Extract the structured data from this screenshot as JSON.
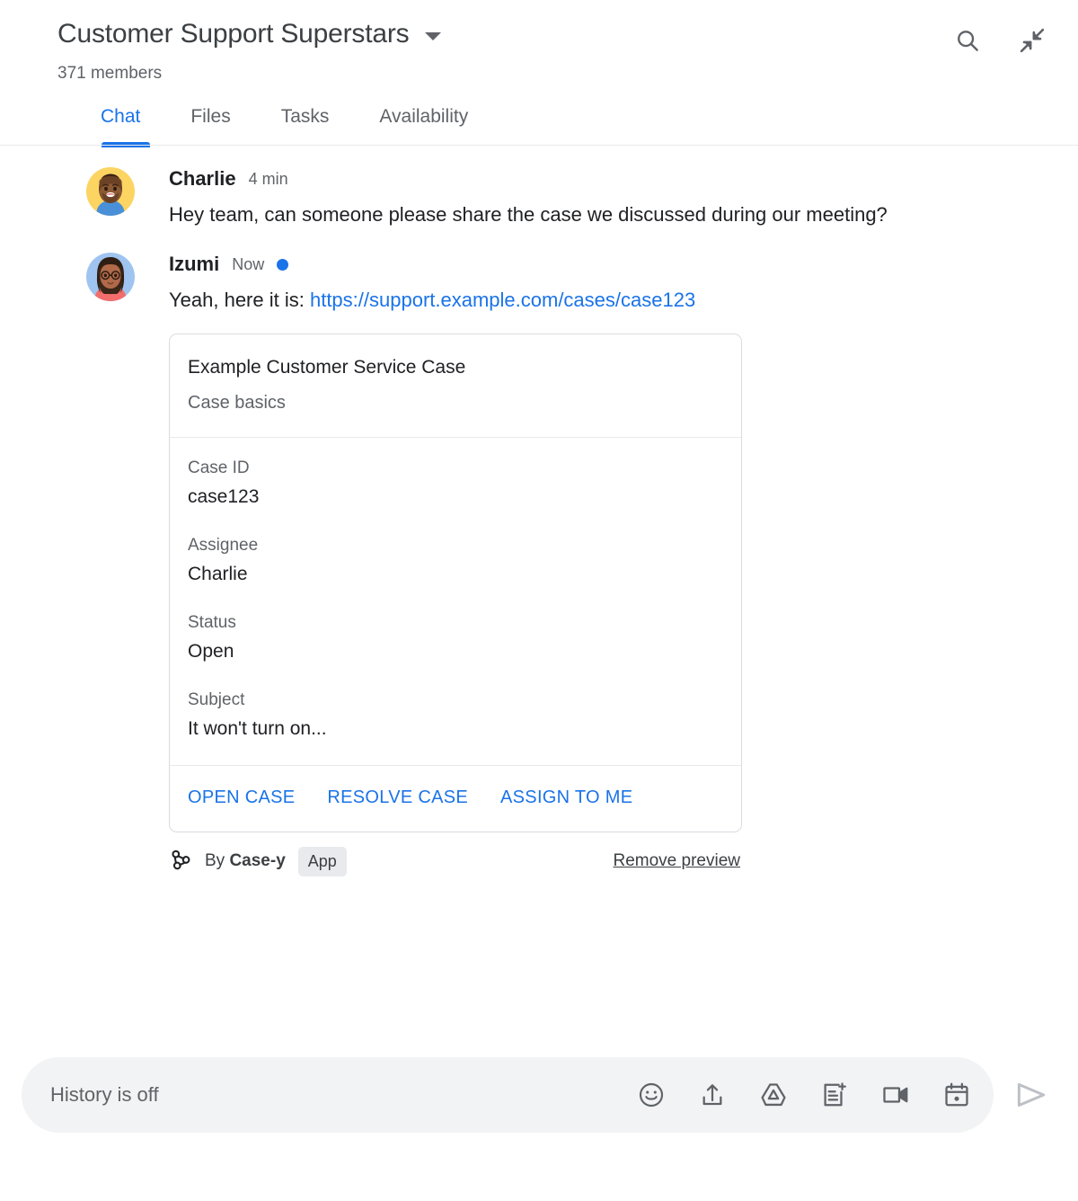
{
  "header": {
    "space_title": "Customer Support Superstars",
    "member_count": "371 members",
    "dropdown_icon": "chevron-down-icon",
    "actions": [
      {
        "name": "search-icon",
        "label": "Search"
      },
      {
        "name": "collapse-icon",
        "label": "Collapse"
      }
    ]
  },
  "tabs": [
    {
      "label": "Chat",
      "active": true
    },
    {
      "label": "Files",
      "active": false
    },
    {
      "label": "Tasks",
      "active": false
    },
    {
      "label": "Availability",
      "active": false
    }
  ],
  "messages": [
    {
      "author": "Charlie",
      "time": "4 min",
      "unread": false,
      "text": "Hey team, can someone please share the case we discussed during our meeting?"
    },
    {
      "author": "Izumi",
      "time": "Now",
      "unread": true,
      "text_prefix": "Yeah, here it is: ",
      "link": "https://support.example.com/cases/case123"
    }
  ],
  "card": {
    "title": "Example Customer Service Case",
    "subtitle": "Case basics",
    "fields": [
      {
        "label": "Case ID",
        "value": "case123"
      },
      {
        "label": "Assignee",
        "value": "Charlie"
      },
      {
        "label": "Status",
        "value": "Open"
      },
      {
        "label": "Subject",
        "value": "It won't turn on..."
      }
    ],
    "actions": [
      {
        "label": "OPEN CASE"
      },
      {
        "label": "RESOLVE CASE"
      },
      {
        "label": "ASSIGN TO ME"
      }
    ]
  },
  "attribution": {
    "icon": "webhook-icon",
    "by_prefix": "By ",
    "app_name": "Case-y",
    "badge": "App",
    "remove_label": "Remove preview"
  },
  "composer": {
    "placeholder": "History is off",
    "icons": [
      {
        "name": "emoji-icon"
      },
      {
        "name": "upload-icon"
      },
      {
        "name": "drive-icon"
      },
      {
        "name": "new-document-icon"
      },
      {
        "name": "video-camera-icon"
      },
      {
        "name": "calendar-icon"
      }
    ],
    "send_label": "Send"
  },
  "colors": {
    "accent": "#1a73e8",
    "text_primary": "#202124",
    "text_secondary": "#5f6368",
    "border": "#dadce0",
    "composer_bg": "#f1f3f4",
    "badge_bg": "#e8eaed"
  }
}
